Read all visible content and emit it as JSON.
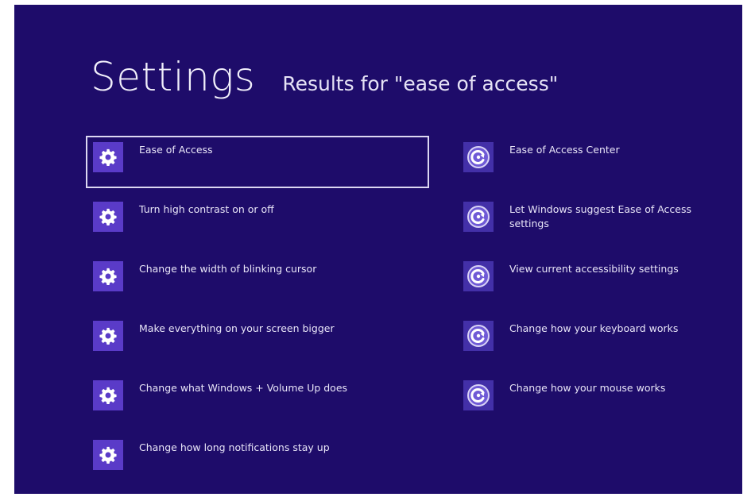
{
  "header": {
    "title": "Settings",
    "subtitle": "Results for \"ease of access\""
  },
  "left_results": [
    {
      "label": "Ease of Access",
      "icon": "gear-icon",
      "selected": true
    },
    {
      "label": "Turn high contrast on or off",
      "icon": "gear-icon"
    },
    {
      "label": "Change the width of blinking cursor",
      "icon": "gear-icon"
    },
    {
      "label": "Make everything on your screen bigger",
      "icon": "gear-icon"
    },
    {
      "label": "Change what Windows + Volume Up does",
      "icon": "gear-icon"
    },
    {
      "label": "Change how long notifications stay up",
      "icon": "gear-icon"
    }
  ],
  "right_results": [
    {
      "label": "Ease of Access Center",
      "icon": "ease-of-access-icon"
    },
    {
      "label": "Let Windows suggest Ease of Access settings",
      "icon": "ease-of-access-icon"
    },
    {
      "label": "View current accessibility settings",
      "icon": "ease-of-access-icon"
    },
    {
      "label": "Change how your keyboard works",
      "icon": "ease-of-access-icon"
    },
    {
      "label": "Change how your mouse works",
      "icon": "ease-of-access-icon"
    }
  ],
  "colors": {
    "background": "#1e0c6a",
    "tile": "#5a3bc8",
    "text": "#e9e6f8",
    "selection_border": "#dcd8f2"
  }
}
